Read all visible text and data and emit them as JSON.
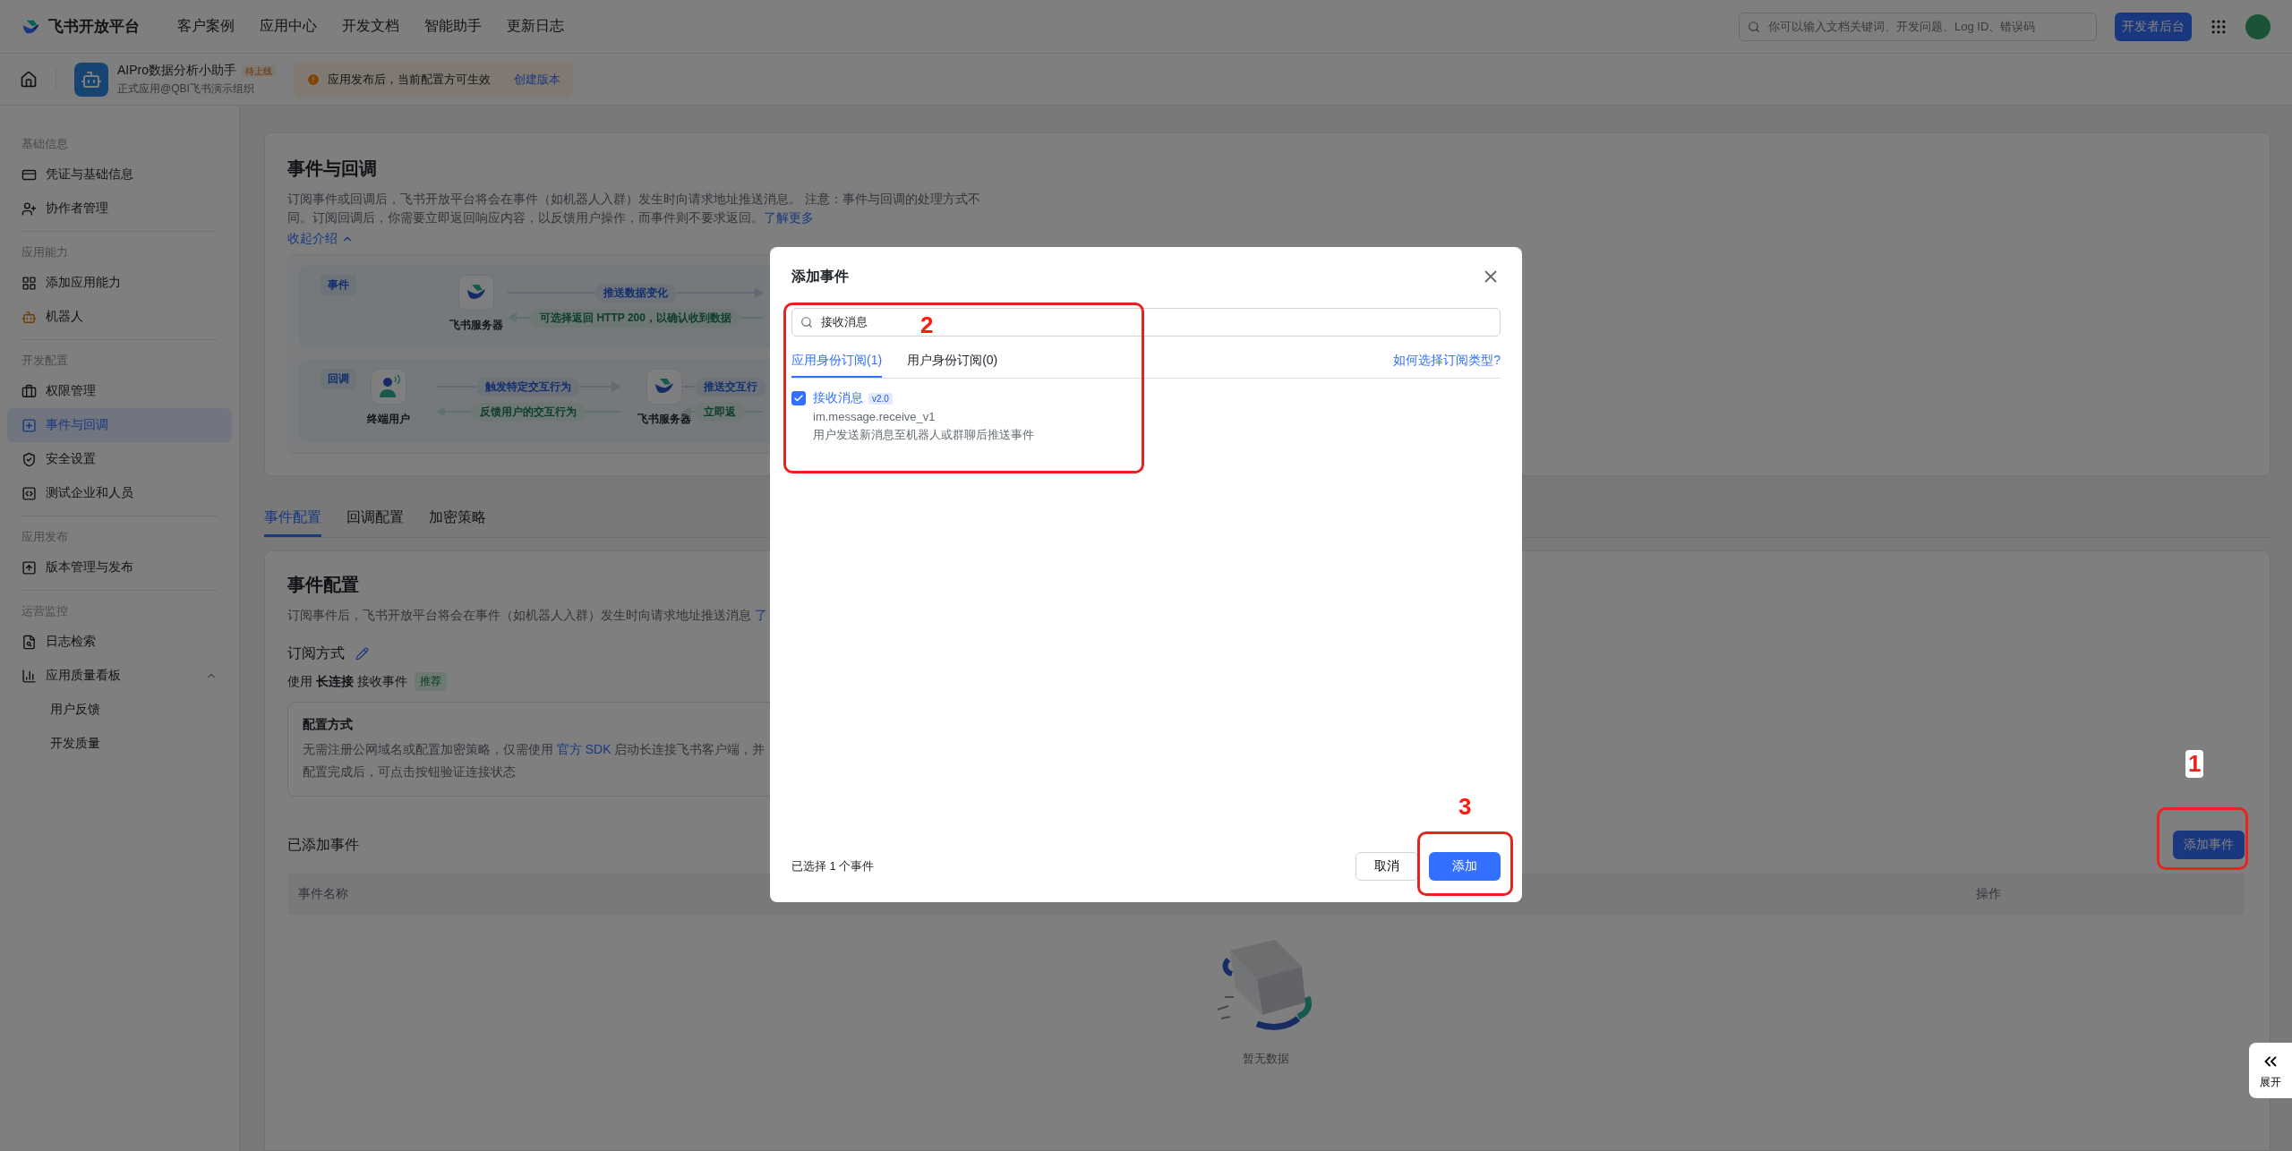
{
  "top_bar": {
    "logo": "飞书开放平台",
    "nav": [
      "客户案例",
      "应用中心",
      "开发文档",
      "智能助手",
      "更新日志"
    ],
    "search": {
      "placeholder": "你可以输入文档关键词、开发问题、Log ID、错误码"
    },
    "console_button": "开发者后台"
  },
  "app_header": {
    "name": "AIPro数据分析小助手",
    "badge": "待上线",
    "org": "正式应用@QBI飞书演示组织",
    "notice": "应用发布后，当前配置方可生效",
    "notice_link": "创建版本"
  },
  "sidebar": {
    "sections": [
      {
        "title": "基础信息",
        "items": [
          {
            "label": "凭证与基础信息",
            "selected": false
          },
          {
            "label": "协作者管理",
            "selected": false
          }
        ]
      },
      {
        "title": "应用能力",
        "items": [
          {
            "label": "添加应用能力",
            "selected": false
          },
          {
            "label": "机器人",
            "selected": false
          }
        ]
      },
      {
        "title": "开发配置",
        "items": [
          {
            "label": "权限管理",
            "selected": false
          },
          {
            "label": "事件与回调",
            "selected": true
          },
          {
            "label": "安全设置",
            "selected": false
          },
          {
            "label": "测试企业和人员",
            "selected": false
          }
        ]
      },
      {
        "title": "应用发布",
        "items": [
          {
            "label": "版本管理与发布",
            "selected": false
          }
        ]
      },
      {
        "title": "运营监控",
        "items": [
          {
            "label": "日志检索",
            "selected": false
          },
          {
            "label": "应用质量看板",
            "selected": false,
            "expanded": true,
            "children": [
              {
                "label": "用户反馈",
                "selected": false
              },
              {
                "label": "开发质量",
                "selected": false
              }
            ]
          }
        ]
      }
    ]
  },
  "intro": {
    "title": "事件与回调",
    "description": "订阅事件或回调后，飞书开放平台将会在事件（如机器人入群）发生时向请求地址推送消息。 注意：事件与回调的处理方式不同。订阅回调后，你需要立即返回响应内容，以反馈用户操作，而事件则不要求返回。",
    "learn_more": "了解更多",
    "collapse": "收起介绍"
  },
  "diagram": {
    "event_row": {
      "tag": "事件",
      "server": "飞书服务器",
      "push": "推送数据变化",
      "reply": "可选择返回 HTTP 200，以确认收到数据"
    },
    "callback_row": {
      "tag": "回调",
      "user": "终端用户",
      "trigger": "触发特定交互行为",
      "feedback": "反馈用户的交互行为",
      "server": "飞书服务器",
      "push": "推送交互行",
      "reply": "立即返"
    }
  },
  "tabs": [
    {
      "label": "事件配置",
      "selected": true
    },
    {
      "label": "回调配置",
      "selected": false
    },
    {
      "label": "加密策略",
      "selected": false
    }
  ],
  "event_config": {
    "title": "事件配置",
    "description": "订阅事件后，飞书开放平台将会在事件（如机器人入群）发生时向请求地址推送消息",
    "learn_more": "了",
    "subscription_title": "订阅方式",
    "subscription_text": "使用 **长连接** 接收事件",
    "recommended_badge": "推荐",
    "method_box": {
      "title": "配置方式",
      "line_before": "无需注册公网域名或配置加密策略，仅需使用",
      "line_link": "官方 SDK",
      "line_after": "启动长连接飞书客户端，并",
      "line_2": "配置完成后，可点击按钮验证连接状态"
    }
  },
  "added_events": {
    "title": "已添加事件",
    "add_button": "添加事件",
    "columns": [
      "事件名称",
      "操作"
    ],
    "empty_text": "暂无数据"
  },
  "expand_tab": "展开",
  "dialog": {
    "title": "添加事件",
    "search_value": "接收消息",
    "tabs": [
      {
        "label": "应用身份订阅(1)",
        "selected": true
      },
      {
        "label": "用户身份订阅(0)",
        "selected": false
      }
    ],
    "help_link": "如何选择订阅类型?",
    "events": [
      {
        "name": "接收消息",
        "version": "v2.0",
        "code": "im.message.receive_v1",
        "description": "用户发送新消息至机器人或群聊后推送事件",
        "checked": true
      }
    ],
    "selected_count": "已选择 1 个事件",
    "cancel_button": "取消",
    "add_button": "添加"
  },
  "annotations": [
    {
      "label": "1"
    },
    {
      "label": "2"
    },
    {
      "label": "3"
    }
  ]
}
